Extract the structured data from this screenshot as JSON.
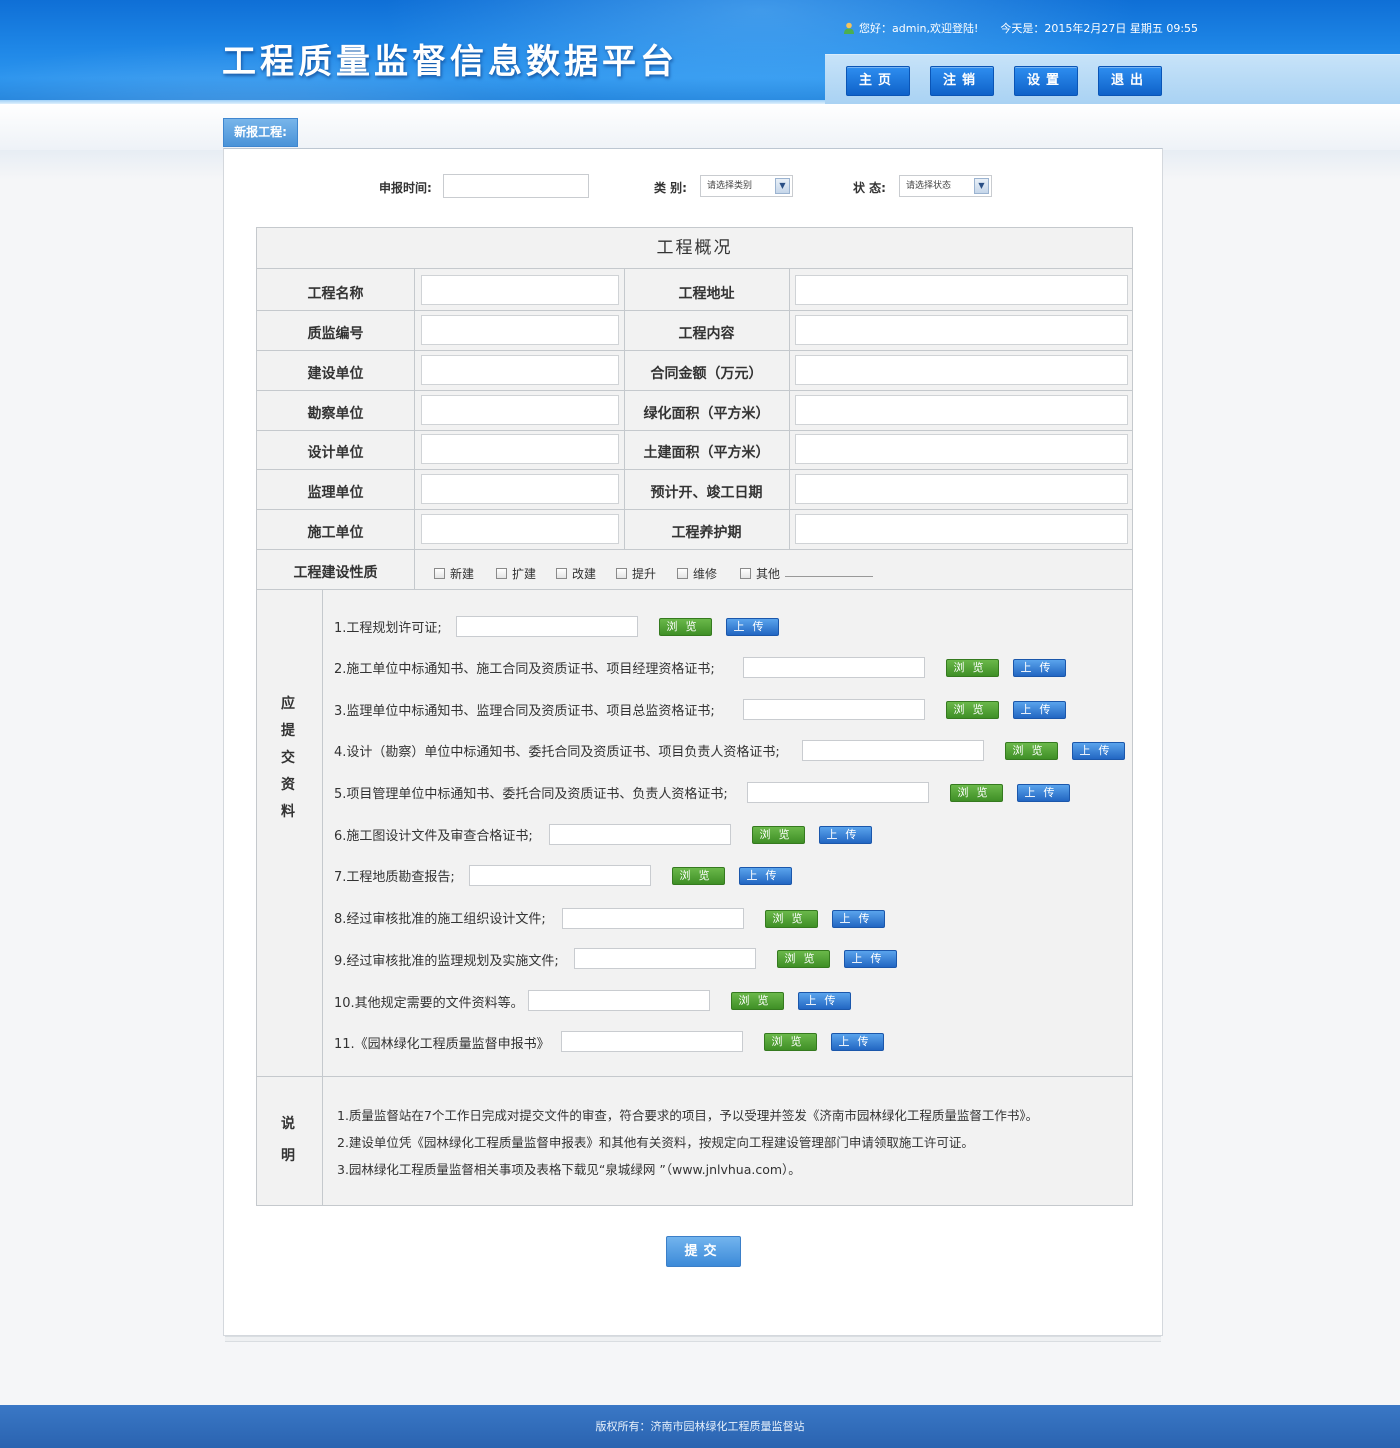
{
  "header": {
    "title": "工程质量监督信息数据平台",
    "greeting": "您好：admin,欢迎登陆!",
    "date": "今天是：2015年2月27日  星期五  09:55",
    "nav": [
      "主页",
      "注销",
      "设置",
      "退出"
    ]
  },
  "tab": {
    "label": "新报工程:"
  },
  "filters": {
    "date_label": "申报时间:",
    "category_label": "类 别:",
    "category_value": "请选择类别",
    "status_label": "状 态:",
    "status_value": "请选择状态"
  },
  "overview": {
    "title": "工程概况",
    "rows": [
      {
        "left": "工程名称",
        "right": "工程地址"
      },
      {
        "left": "质监编号",
        "right": "工程内容"
      },
      {
        "left": "建设单位",
        "right": "合同金额（万元）"
      },
      {
        "left": "勘察单位",
        "right": "绿化面积（平方米）"
      },
      {
        "left": "设计单位",
        "right": "土建面积（平方米）"
      },
      {
        "left": "监理单位",
        "right": "预计开、竣工日期"
      },
      {
        "left": "施工单位",
        "right": "工程养护期"
      }
    ],
    "nature_label": "工程建设性质",
    "nature_options": [
      "新建",
      "扩建",
      "改建",
      "提升",
      "维修",
      "其他"
    ]
  },
  "documents": {
    "section_label": [
      "应",
      "提",
      "交",
      "资",
      "料"
    ],
    "items": [
      "1.工程规划许可证;",
      "2.施工单位中标通知书、施工合同及资质证书、项目经理资格证书;",
      "3.监理单位中标通知书、监理合同及资质证书、项目总监资格证书;",
      "4.设计（勘察）单位中标通知书、委托合同及资质证书、项目负责人资格证书;",
      "5.项目管理单位中标通知书、委托合同及资质证书、负责人资格证书;",
      "6.施工图设计文件及审查合格证书;",
      "7.工程地质勘查报告;",
      "8.经过审核批准的施工组织设计文件;",
      "9.经过审核批准的监理规划及实施文件;",
      "10.其他规定需要的文件资料等。",
      "11.《园林绿化工程质量监督申报书》"
    ],
    "browse_label": "浏览",
    "upload_label": "上传"
  },
  "notes": {
    "section_label": [
      "说",
      "明"
    ],
    "lines": [
      "1.质量监督站在7个工作日完成对提交文件的审查，符合要求的项目，予以受理并签发《济南市园林绿化工程质量监督工作书》。",
      "2.建设单位凭《园林绿化工程质量监督申报表》和其他有关资料，按规定向工程建设管理部门申请领取施工许可证。",
      "3.园林绿化工程质量监督相关事项及表格下载见“泉城绿网 ”（www.jnlvhua.com）。"
    ]
  },
  "submit_label": "提交",
  "footer": "版权所有：济南市园林绿化工程质量监督站"
}
